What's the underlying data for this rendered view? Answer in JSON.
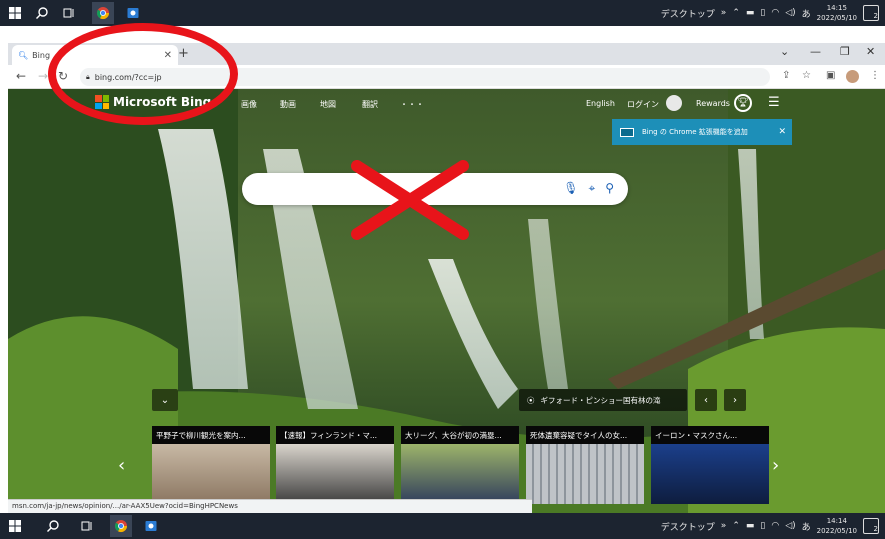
{
  "taskbar_top": {
    "desktop_label": "デスクトップ",
    "ime_label": "あ",
    "time": "14:15",
    "date": "2022/05/10",
    "notifications": "2"
  },
  "taskbar_bottom": {
    "desktop_label": "デスクトップ",
    "ime_label": "あ",
    "time": "14:14",
    "date": "2022/05/10",
    "notifications": "2"
  },
  "browser": {
    "tab_title": "Bing",
    "url": "bing.com/?cc=jp"
  },
  "bing": {
    "logo_text": "Microsoft Bing",
    "nav": [
      "画像",
      "動画",
      "地図",
      "翻訳",
      "・・・"
    ],
    "language": "English",
    "login": "ログイン",
    "rewards": "Rewards",
    "promo_text": "Bing の Chrome 拡張機能を追加",
    "location": "ギフォード・ピンショー国有林の滝",
    "news": [
      "平野子で柳川観光を案内...",
      "【速報】フィンランド・マ...",
      "大リーグ、大谷が初の満塁...",
      "死体遺棄容疑でタイ人の女...",
      "イーロン・マスクさん..."
    ],
    "status_url": "msn.com/ja-jp/news/opinion/.../ar-AAX5Uew?ocid=BingHPCNews"
  },
  "colors": {
    "annotation_red": "#e8141a",
    "taskbar": "#1c2430",
    "promo": "#1d8fb8"
  }
}
